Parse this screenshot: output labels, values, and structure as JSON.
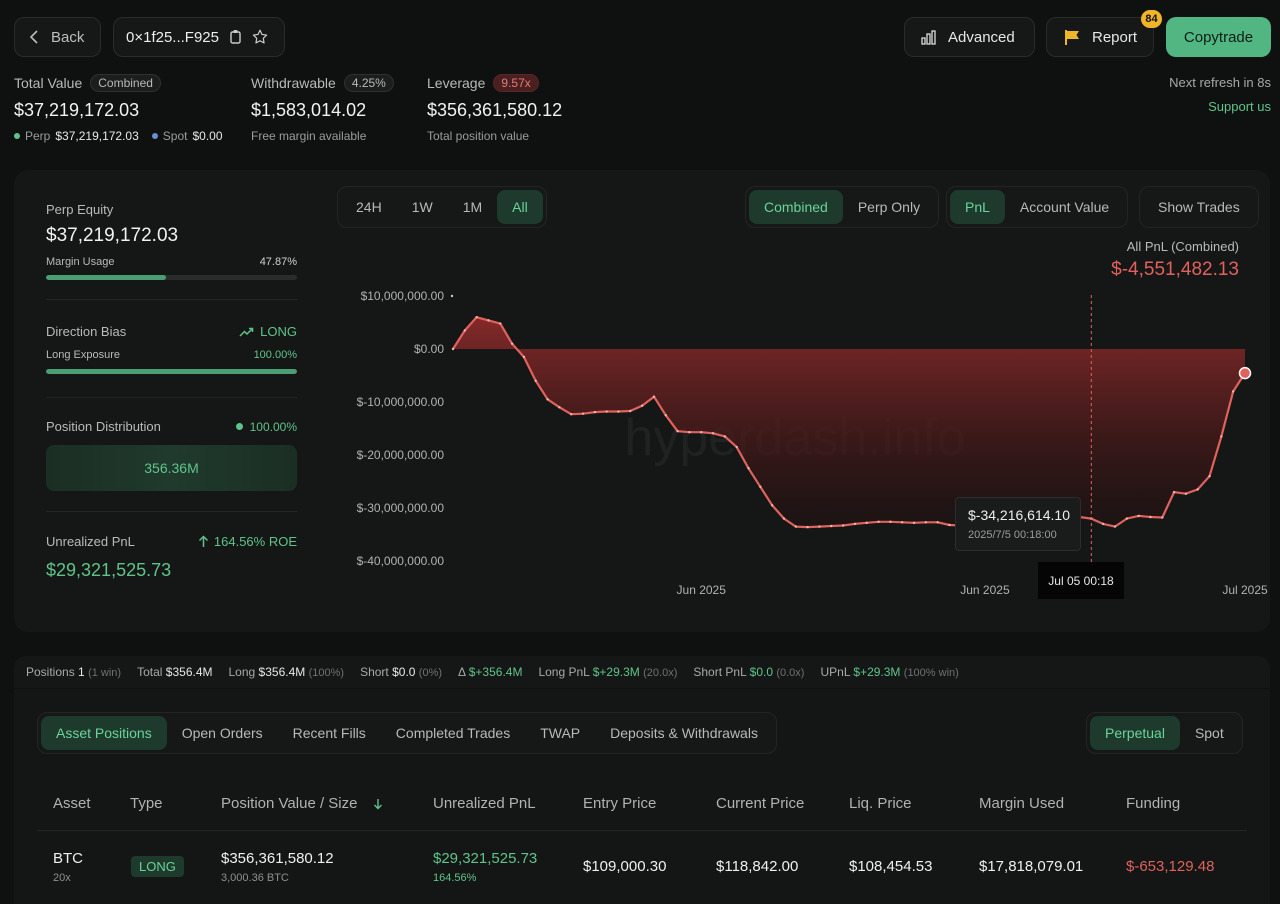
{
  "header": {
    "back_label": "Back",
    "address": "0×1f25...F925",
    "advanced_label": "Advanced",
    "report_label": "Report",
    "report_badge": "84",
    "copytrade_label": "Copytrade"
  },
  "summary": {
    "total_value_label": "Total Value",
    "total_value_badge": "Combined",
    "total_value": "$37,219,172.03",
    "perp_label": "Perp",
    "perp_value": "$37,219,172.03",
    "spot_label": "Spot",
    "spot_value": "$0.00",
    "withdrawable_label": "Withdrawable",
    "withdrawable_badge": "4.25%",
    "withdrawable_value": "$1,583,014.02",
    "withdrawable_sub": "Free margin available",
    "leverage_label": "Leverage",
    "leverage_badge": "9.57x",
    "leverage_value": "$356,361,580.12",
    "leverage_sub": "Total position value",
    "refresh_text": "Next refresh in 8s",
    "support_label": "Support us"
  },
  "left_panel": {
    "perp_equity_label": "Perp Equity",
    "perp_equity_value": "$37,219,172.03",
    "margin_usage_label": "Margin Usage",
    "margin_usage_value": "47.87%",
    "margin_usage_fraction": 0.4787,
    "direction_label": "Direction Bias",
    "direction_value": "LONG",
    "long_exposure_label": "Long Exposure",
    "long_exposure_value": "100.00%",
    "long_exposure_fraction": 1.0,
    "position_dist_label": "Position Distribution",
    "position_dist_value": "100.00%",
    "position_dist_amount": "356.36M",
    "upnl_label": "Unrealized PnL",
    "upnl_roe": "164.56% ROE",
    "upnl_value": "$29,321,525.73"
  },
  "chart_controls": {
    "range_tabs": [
      "24H",
      "1W",
      "1M",
      "All"
    ],
    "active_range": "All",
    "mode_tabs": [
      "Combined",
      "Perp Only"
    ],
    "active_mode": "Combined",
    "metric_tabs": [
      "PnL",
      "Account Value"
    ],
    "active_metric": "PnL",
    "show_trades_label": "Show Trades"
  },
  "chart_header": {
    "label": "All PnL (Combined)",
    "value": "$-4,551,482.13"
  },
  "watermark": "hyperdash.info",
  "tooltip": {
    "value": "$-34,216,614.10",
    "date": "2025/7/5 00:18:00",
    "x_label": "Jul 05 00:18"
  },
  "chart_data": {
    "type": "area",
    "title": "All PnL (Combined)",
    "ylim": [
      -40000000,
      10000000
    ],
    "y_ticks": [
      "$10,000,000.00",
      "$0.00",
      "$-10,000,000.00",
      "$-20,000,000.00",
      "$-30,000,000.00",
      "$-40,000,000.00"
    ],
    "y_tick_values": [
      10000000,
      0,
      -10000000,
      -20000000,
      -30000000,
      -40000000
    ],
    "x_ticks": [
      "Jun 2025",
      "Jun 2025",
      "Jul 2025",
      "Jul 2025"
    ],
    "x_tick_index": [
      21,
      45,
      67,
      88
    ],
    "series": [
      {
        "values": [
          0,
          3500000,
          6000000,
          5400000,
          4800000,
          1000000,
          -1500000,
          -6000000,
          -9500000,
          -11000000,
          -12300000,
          -12200000,
          -11900000,
          -11800000,
          -11800000,
          -11700000,
          -10700000,
          -9000000,
          -12500000,
          -15500000,
          -15700000,
          -15700000,
          -15900000,
          -16500000,
          -18500000,
          -22500000,
          -26000000,
          -29500000,
          -32000000,
          -33500000,
          -33600000,
          -33500000,
          -33400000,
          -33300000,
          -33000000,
          -32800000,
          -32600000,
          -32600000,
          -32700000,
          -32800000,
          -32700000,
          -32700000,
          -33200000,
          -33300000,
          -33500000,
          -33300000,
          -34216614,
          -34000000,
          -33400000,
          -33300000,
          -33300000,
          -33200000,
          -32300000,
          -31700000,
          -32000000,
          -33000000,
          -33500000,
          -32000000,
          -31500000,
          -31700000,
          -31800000,
          -27000000,
          -27300000,
          -26500000,
          -24000000,
          -16500000,
          -8000000,
          -4551482
        ]
      }
    ]
  },
  "stats_bar": {
    "positions_label": "Positions",
    "positions_value": "1",
    "positions_sub": "(1 win)",
    "total_label": "Total",
    "total_value": "$356.4M",
    "long_label": "Long",
    "long_value": "$356.4M",
    "long_sub": "(100%)",
    "short_label": "Short",
    "short_value": "$0.0",
    "short_sub": "(0%)",
    "delta_label": "Δ",
    "delta_value": "$+356.4M",
    "long_pnl_label": "Long PnL",
    "long_pnl_value": "$+29.3M",
    "long_pnl_sub": "(20.0x)",
    "short_pnl_label": "Short PnL",
    "short_pnl_value": "$0.0",
    "short_pnl_sub": "(0.0x)",
    "upnl_label": "UPnL",
    "upnl_value": "$+29.3M",
    "upnl_sub": "(100% win)"
  },
  "tabs": {
    "items": [
      "Asset Positions",
      "Open Orders",
      "Recent Fills",
      "Completed Trades",
      "TWAP",
      "Deposits & Withdrawals"
    ],
    "active": "Asset Positions",
    "market_items": [
      "Perpetual",
      "Spot"
    ],
    "active_market": "Perpetual"
  },
  "table": {
    "headers": [
      "Asset",
      "Type",
      "Position Value / Size",
      "Unrealized PnL",
      "Entry Price",
      "Current Price",
      "Liq. Price",
      "Margin Used",
      "Funding"
    ],
    "rows": [
      {
        "asset": "BTC",
        "leverage": "20x",
        "type": "LONG",
        "position_value": "$356,361,580.12",
        "size": "3,000.36 BTC",
        "upnl": "$29,321,525.73",
        "upnl_pct": "164.56%",
        "entry_price": "$109,000.30",
        "current_price": "$118,842.00",
        "liq_price": "$108,454.53",
        "margin_used": "$17,818,079.01",
        "funding": "$-653,129.48"
      }
    ]
  },
  "colors": {
    "accent": "#5fc48a",
    "negative": "#e0625c",
    "background": "#0f1010"
  }
}
